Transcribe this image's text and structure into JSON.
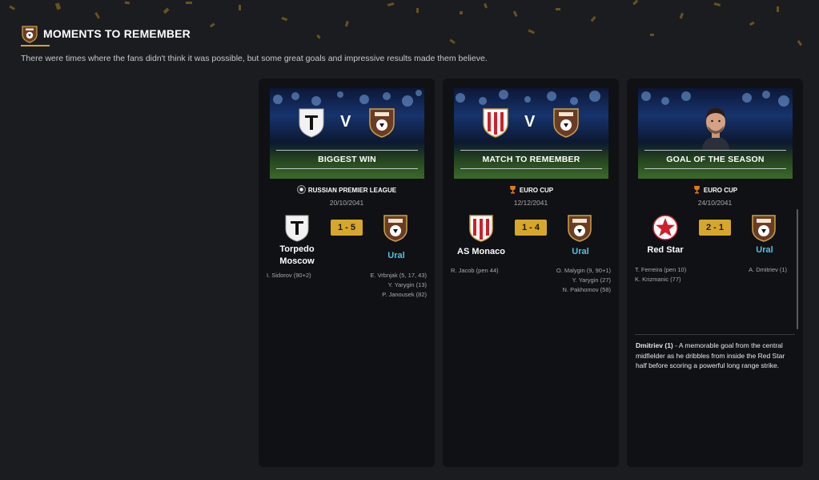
{
  "header": {
    "title": "MOMENTS TO REMEMBER",
    "subtitle": "There were times where the fans didn't think it was possible, but some great goals and impressive results made them believe."
  },
  "colors": {
    "background": "#1b1c20",
    "card": "#101114",
    "score_badge": "#d6a72a",
    "accent_gold": "#d7a52a",
    "team_highlight": "#4ec3e0"
  },
  "cards": [
    {
      "label": "BIGGEST WIN",
      "image": "match-versus",
      "versus": "V",
      "competition": "RUSSIAN PREMIER LEAGUE",
      "competition_icon": "league-icon",
      "date": "20/10/2041",
      "score": "1 - 5",
      "home": {
        "name": "Torpedo Moscow",
        "crest": "torpedo-crest",
        "scorers": [
          "I. Sidorov (90+2)"
        ]
      },
      "away": {
        "name": "Ural",
        "crest": "ural-crest",
        "scorers": [
          "E. Vrbnjak (5, 17, 43)",
          "Y. Yarygin (13)",
          "P. Janousek (82)"
        ]
      }
    },
    {
      "label": "MATCH TO REMEMBER",
      "image": "match-versus",
      "versus": "V",
      "competition": "EURO CUP",
      "competition_icon": "trophy-icon",
      "date": "12/12/2041",
      "score": "1 - 4",
      "home": {
        "name": "AS Monaco",
        "crest": "monaco-crest",
        "scorers": [
          "R. Jacob (pen 44)"
        ]
      },
      "away": {
        "name": "Ural",
        "crest": "ural-crest",
        "scorers": [
          "O. Malygin (9, 90+1)",
          "Y. Yarygin (27)",
          "N. Pakhomov (58)"
        ]
      }
    },
    {
      "label": "GOAL OF THE SEASON",
      "image": "player-portrait",
      "competition": "EURO CUP",
      "competition_icon": "trophy-icon",
      "date": "24/10/2041",
      "score": "2 - 1",
      "home": {
        "name": "Red Star",
        "crest": "red-star-crest",
        "scorers": [
          "T. Ferreira (pen 10)",
          "K. Krizmanic (77)"
        ]
      },
      "away": {
        "name": "Ural",
        "crest": "ural-crest",
        "scorers": [
          "A. Dmitriev (1)"
        ]
      },
      "description_player": "Dmitriev (1)",
      "description": " - A memorable goal from the central midfielder as he dribbles from inside the Red Star half before scoring a powerful long range strike."
    }
  ]
}
